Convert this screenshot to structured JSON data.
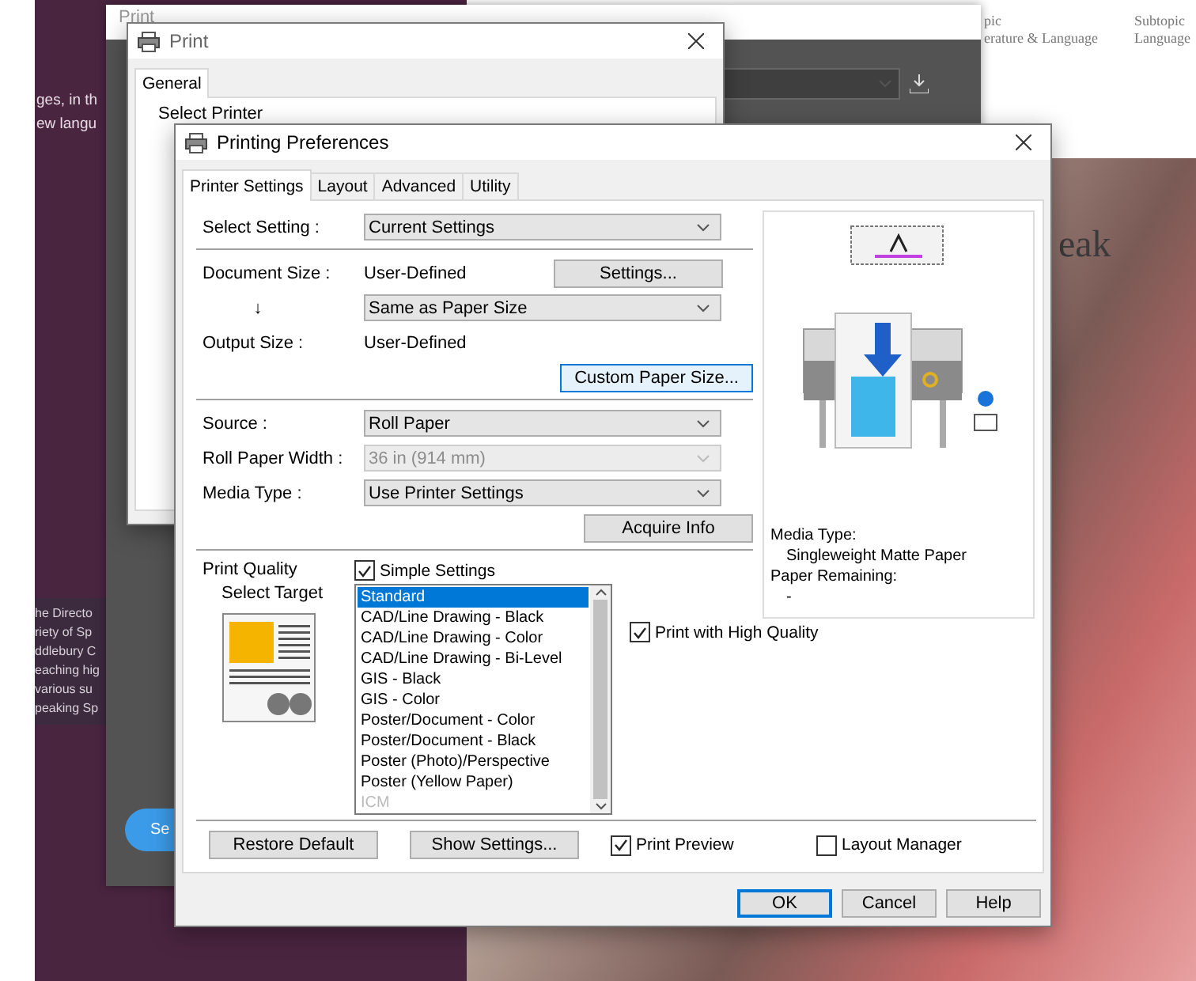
{
  "background": {
    "intro_fragments": [
      "ges, in th",
      "ew langu"
    ],
    "bio_fragments": [
      "he Directo",
      "riety of Sp",
      "ddlebury C",
      "eaching hig",
      "various su",
      "peaking Sp"
    ],
    "topics": [
      {
        "kicker": "pic",
        "name": "erature & Language"
      },
      {
        "kicker": "Subtopic",
        "name": "Language"
      }
    ],
    "heading_fragment": "eak"
  },
  "back_app": {
    "title": "Print",
    "button": "Se"
  },
  "print_dialog": {
    "title": "Print",
    "tabs": [
      {
        "label": "General",
        "selected": true
      }
    ],
    "group_label": "Select Printer"
  },
  "preferences": {
    "title": "Printing Preferences",
    "tabs": [
      {
        "label": "Printer Settings",
        "selected": true
      },
      {
        "label": "Layout",
        "selected": false
      },
      {
        "label": "Advanced",
        "selected": false
      },
      {
        "label": "Utility",
        "selected": false
      }
    ],
    "sections": [
      [
        {
          "kind": "select",
          "label": "Select Setting :",
          "value": "Current Settings",
          "disabled": false
        }
      ],
      [
        {
          "kind": "text",
          "label": "Document Size :",
          "value": "User-Defined",
          "button": "Settings..."
        },
        {
          "kind": "arrow_select",
          "label": "↓",
          "value": "Same as Paper Size",
          "disabled": false
        },
        {
          "kind": "text",
          "label": "Output Size :",
          "value": "User-Defined"
        },
        {
          "kind": "button",
          "button": "Custom Paper Size...",
          "highlighted": true
        }
      ],
      [
        {
          "kind": "select",
          "label": "Source :",
          "value": "Roll Paper",
          "disabled": false
        },
        {
          "kind": "select",
          "label": "Roll Paper Width :",
          "value": "36 in (914 mm)",
          "disabled": true
        },
        {
          "kind": "select",
          "label": "Media Type :",
          "value": "Use Printer Settings",
          "disabled": false
        },
        {
          "kind": "button",
          "button": "Acquire Info",
          "highlighted": false
        }
      ]
    ],
    "preview": {
      "media_type_label": "Media Type:",
      "media_type": "Singleweight Matte Paper",
      "paper_remaining_label": "Paper Remaining:",
      "paper_remaining": "-"
    },
    "print_quality": {
      "label": "Print Quality",
      "simple_settings": {
        "label": "Simple Settings",
        "checked": true
      },
      "select_target": "Select Target",
      "targets": [
        {
          "label": "Standard",
          "selected": true,
          "disabled": false
        },
        {
          "label": "CAD/Line Drawing - Black",
          "selected": false,
          "disabled": false
        },
        {
          "label": "CAD/Line Drawing - Color",
          "selected": false,
          "disabled": false
        },
        {
          "label": "CAD/Line Drawing - Bi-Level",
          "selected": false,
          "disabled": false
        },
        {
          "label": "GIS - Black",
          "selected": false,
          "disabled": false
        },
        {
          "label": "GIS - Color",
          "selected": false,
          "disabled": false
        },
        {
          "label": "Poster/Document - Color",
          "selected": false,
          "disabled": false
        },
        {
          "label": "Poster/Document - Black",
          "selected": false,
          "disabled": false
        },
        {
          "label": "Poster (Photo)/Perspective",
          "selected": false,
          "disabled": false
        },
        {
          "label": "Poster (Yellow Paper)",
          "selected": false,
          "disabled": false
        },
        {
          "label": "ICM",
          "selected": false,
          "disabled": true
        }
      ],
      "high_quality": {
        "label": "Print with High Quality",
        "checked": true
      }
    },
    "footer_buttons": [
      "Restore Default",
      "Show Settings..."
    ],
    "footer_checks": [
      {
        "label": "Print Preview",
        "checked": true
      },
      {
        "label": "Layout Manager",
        "checked": false
      }
    ],
    "dialog_buttons": [
      {
        "label": "OK",
        "default": true
      },
      {
        "label": "Cancel",
        "default": false
      },
      {
        "label": "Help",
        "default": false
      }
    ]
  }
}
